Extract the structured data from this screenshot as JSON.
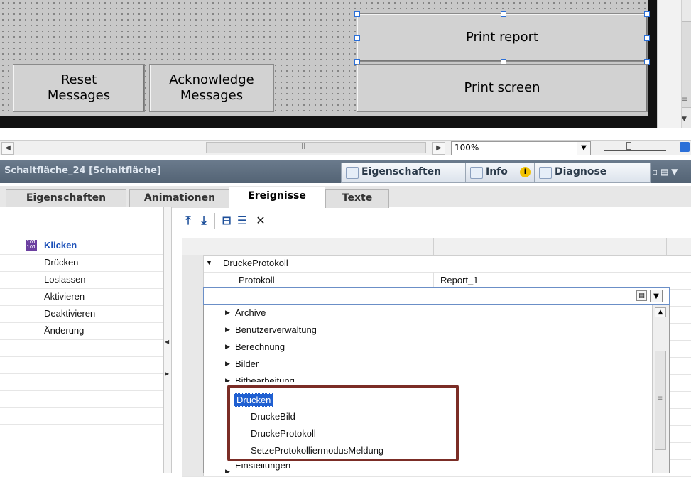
{
  "canvas": {
    "buttons": {
      "print_report": "Print report",
      "print_screen": "Print screen",
      "reset_messages": "Reset\nMessages",
      "acknowledge_messages": "Acknowledge\nMessages"
    },
    "zoom_value": "100%"
  },
  "inspector": {
    "title": "Schaltfläche_24 [Schaltfläche]",
    "tabs": {
      "properties": "Eigenschaften",
      "info": "Info",
      "diagnostics": "Diagnose"
    },
    "subtabs": [
      "Eigenschaften",
      "Animationen",
      "Ereignisse",
      "Texte"
    ],
    "active_subtab": "Ereignisse"
  },
  "events": {
    "selected": "Klicken",
    "items": [
      "Klicken",
      "Drücken",
      "Loslassen",
      "Aktivieren",
      "Deaktivieren",
      "Änderung"
    ]
  },
  "function_list": {
    "function_name": "DruckeProtokoll",
    "param_name": "Protokoll",
    "param_value": "Report_1",
    "dropdown_items": [
      {
        "label": "Archive",
        "expanded": false
      },
      {
        "label": "Benutzerverwaltung",
        "expanded": false
      },
      {
        "label": "Berechnung",
        "expanded": false
      },
      {
        "label": "Bilder",
        "expanded": false
      },
      {
        "label": "Bitbearbeitung",
        "expanded": false
      },
      {
        "label": "Drucken",
        "expanded": true
      },
      {
        "label": "DruckeBild",
        "child": true
      },
      {
        "label": "DruckeProtokoll",
        "child": true
      },
      {
        "label": "SetzeProtokolliermodusMeldung",
        "child": true
      },
      {
        "label": "Einstellungen",
        "expanded": false
      }
    ]
  },
  "colors": {
    "highlight": "#7b2d26",
    "header_bg": "#5e6e80",
    "selected_event": "#1a4fb8"
  }
}
